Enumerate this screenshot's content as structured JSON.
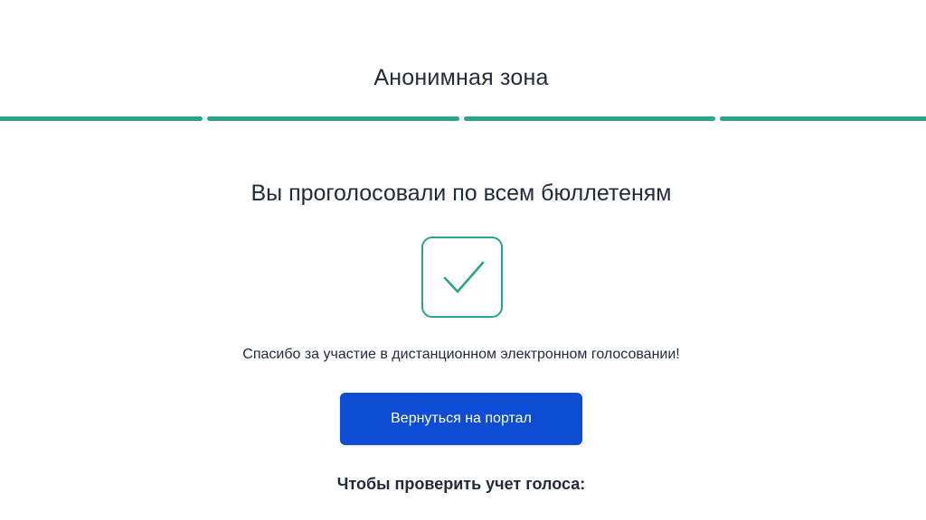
{
  "header": {
    "title": "Анонимная зона"
  },
  "progress": {
    "segments_total": 4,
    "segments_completed": 4,
    "color": "#2aa58b"
  },
  "result": {
    "heading": "Вы проголосовали по всем бюллетеням",
    "icon": "check-icon",
    "icon_color": "#2aa58b",
    "message": "Спасибо за участие в дистанционном электронном голосовании!"
  },
  "actions": {
    "return_label": "Вернуться на портал",
    "button_color": "#0d4cd3"
  },
  "verify": {
    "title": "Чтобы проверить учет голоса:"
  }
}
